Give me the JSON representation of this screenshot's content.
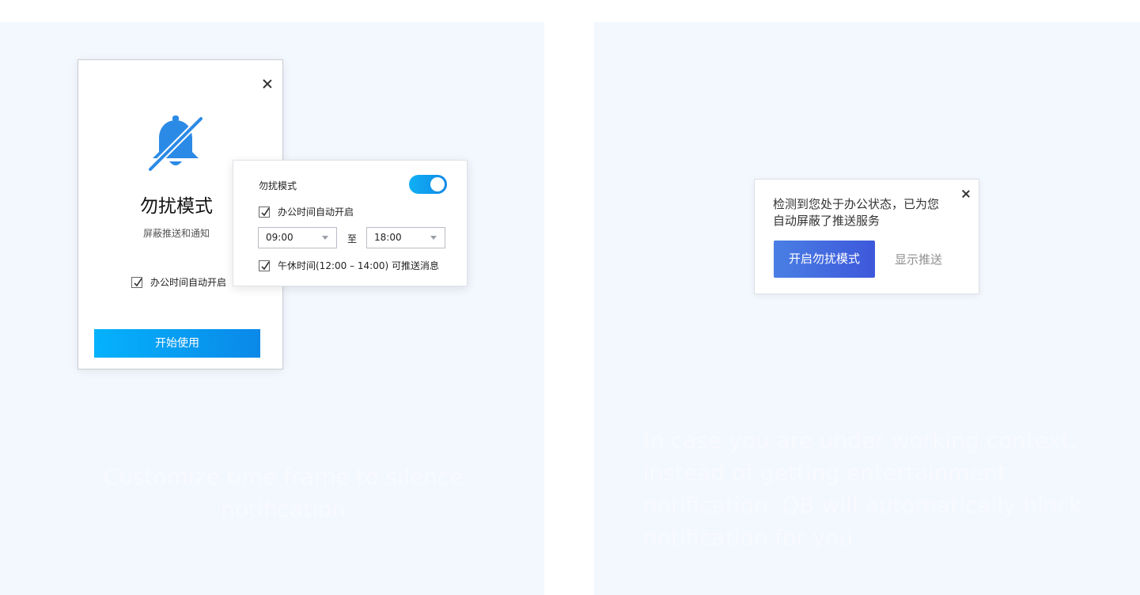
{
  "left_dialog": {
    "title": "勿扰模式",
    "subtitle": "屏蔽推送和通知",
    "auto_enable_label": "办公时间自动开启",
    "auto_enable_checked": true,
    "start_button": "开始使用"
  },
  "settings_popup": {
    "title": "勿扰模式",
    "toggle_on": true,
    "auto_enable_label": "办公时间自动开启",
    "auto_enable_checked": true,
    "start_time": "09:00",
    "to_label": "至",
    "end_time": "18:00",
    "lunch_label": "午休时间(12:00 – 14:00) 可推送消息",
    "lunch_checked": true
  },
  "right_card": {
    "message": "检测到您处于办公状态，已为您自动屏蔽了推送服务",
    "primary_button": "开启勿扰模式",
    "secondary_link": "显示推送"
  },
  "captions": {
    "left": "Customize time frame to silence notification",
    "right": "In case you are under working context, instead of getting entertainment notification, QB will automatically block notification for you"
  },
  "colors": {
    "panel_bg": "#f3f7fe",
    "accent_blue": "#1c8ae8",
    "primary_button": "#4567de"
  },
  "icons": [
    "close-icon",
    "bell-off-icon",
    "checkmark-icon",
    "dropdown-arrow-icon"
  ]
}
